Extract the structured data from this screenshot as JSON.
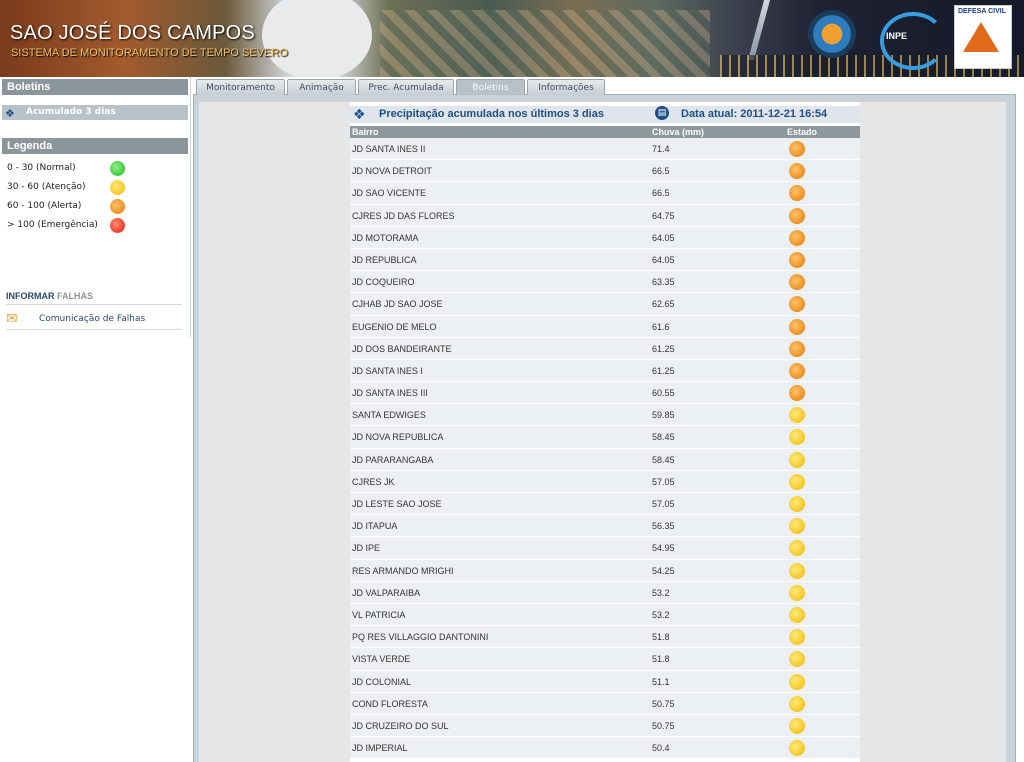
{
  "header": {
    "title": "SAO JOSÉ DOS CAMPOS",
    "subtitle": "SISTEMA DE MONITORAMENTO DE TEMPO SEVERO",
    "logo_defesa": "DEFESA CIVIL",
    "logo_inpe": "INPE"
  },
  "sidebar": {
    "boletins_title": "Boletins",
    "boletins_link": "Acumulado 3 dias",
    "legenda_title": "Legenda",
    "legend": [
      {
        "label": "0 - 30 (Normal)",
        "color": "green"
      },
      {
        "label": "30 - 60 (Atenção)",
        "color": "yellow"
      },
      {
        "label": "60 - 100 (Alerta)",
        "color": "orange"
      },
      {
        "label": "> 100 (Emergência)",
        "color": "red"
      }
    ],
    "informar_a": "INFORMAR",
    "informar_b": "FALHAS",
    "falhas_link": "Comunicação de Falhas"
  },
  "tabs": [
    "Monitoramento",
    "Animação",
    "Prec. Acumulada",
    "Boletins",
    "Informações"
  ],
  "active_tab": "Boletins",
  "panel": {
    "title": "Precipitação acumulada nos últimos 3 dias",
    "date_label": "Data atual: 2011-12-21 16:54",
    "col_bairro": "Bairro",
    "col_chuva": "Chuva (mm)",
    "col_estado": "Estado"
  },
  "colors": {
    "green": "#1cb81a",
    "yellow": "#f0b800",
    "orange": "#e57800",
    "red": "#e01c08"
  },
  "rows": [
    {
      "bairro": "JD SANTA INES II",
      "chuva": "71.4",
      "estado": "orange"
    },
    {
      "bairro": "JD NOVA DETROIT",
      "chuva": "66.5",
      "estado": "orange"
    },
    {
      "bairro": "JD SAO VICENTE",
      "chuva": "66.5",
      "estado": "orange"
    },
    {
      "bairro": "CJRES JD DAS FLORES",
      "chuva": "64.75",
      "estado": "orange"
    },
    {
      "bairro": "JD MOTORAMA",
      "chuva": "64.05",
      "estado": "orange"
    },
    {
      "bairro": "JD REPUBLICA",
      "chuva": "64.05",
      "estado": "orange"
    },
    {
      "bairro": "JD COQUEIRO",
      "chuva": "63.35",
      "estado": "orange"
    },
    {
      "bairro": "CJHAB JD SAO JOSE",
      "chuva": "62.65",
      "estado": "orange"
    },
    {
      "bairro": "EUGENIO DE MELO",
      "chuva": "61.6",
      "estado": "orange"
    },
    {
      "bairro": "JD DOS BANDEIRANTE",
      "chuva": "61.25",
      "estado": "orange"
    },
    {
      "bairro": "JD SANTA INES I",
      "chuva": "61.25",
      "estado": "orange"
    },
    {
      "bairro": "JD SANTA INES III",
      "chuva": "60.55",
      "estado": "orange"
    },
    {
      "bairro": "SANTA EDWIGES",
      "chuva": "59.85",
      "estado": "yellow"
    },
    {
      "bairro": "JD NOVA REPUBLICA",
      "chuva": "58.45",
      "estado": "yellow"
    },
    {
      "bairro": "JD PARARANGABA",
      "chuva": "58.45",
      "estado": "yellow"
    },
    {
      "bairro": "CJRES JK",
      "chuva": "57.05",
      "estado": "yellow"
    },
    {
      "bairro": "JD LESTE SAO JOSE",
      "chuva": "57.05",
      "estado": "yellow"
    },
    {
      "bairro": "JD ITAPUA",
      "chuva": "56.35",
      "estado": "yellow"
    },
    {
      "bairro": "JD IPE",
      "chuva": "54.95",
      "estado": "yellow"
    },
    {
      "bairro": "RES ARMANDO MRIGHI",
      "chuva": "54.25",
      "estado": "yellow"
    },
    {
      "bairro": "JD VALPARAIBA",
      "chuva": "53.2",
      "estado": "yellow"
    },
    {
      "bairro": "VL PATRICIA",
      "chuva": "53.2",
      "estado": "yellow"
    },
    {
      "bairro": "PQ RES VILLAGGIO DANTONINI",
      "chuva": "51.8",
      "estado": "yellow"
    },
    {
      "bairro": "VISTA VERDE",
      "chuva": "51.8",
      "estado": "yellow"
    },
    {
      "bairro": "JD COLONIAL",
      "chuva": "51.1",
      "estado": "yellow"
    },
    {
      "bairro": "COND FLORESTA",
      "chuva": "50.75",
      "estado": "yellow"
    },
    {
      "bairro": "JD CRUZEIRO DO SUL",
      "chuva": "50.75",
      "estado": "yellow"
    },
    {
      "bairro": "JD IMPERIAL",
      "chuva": "50.4",
      "estado": "yellow"
    }
  ]
}
